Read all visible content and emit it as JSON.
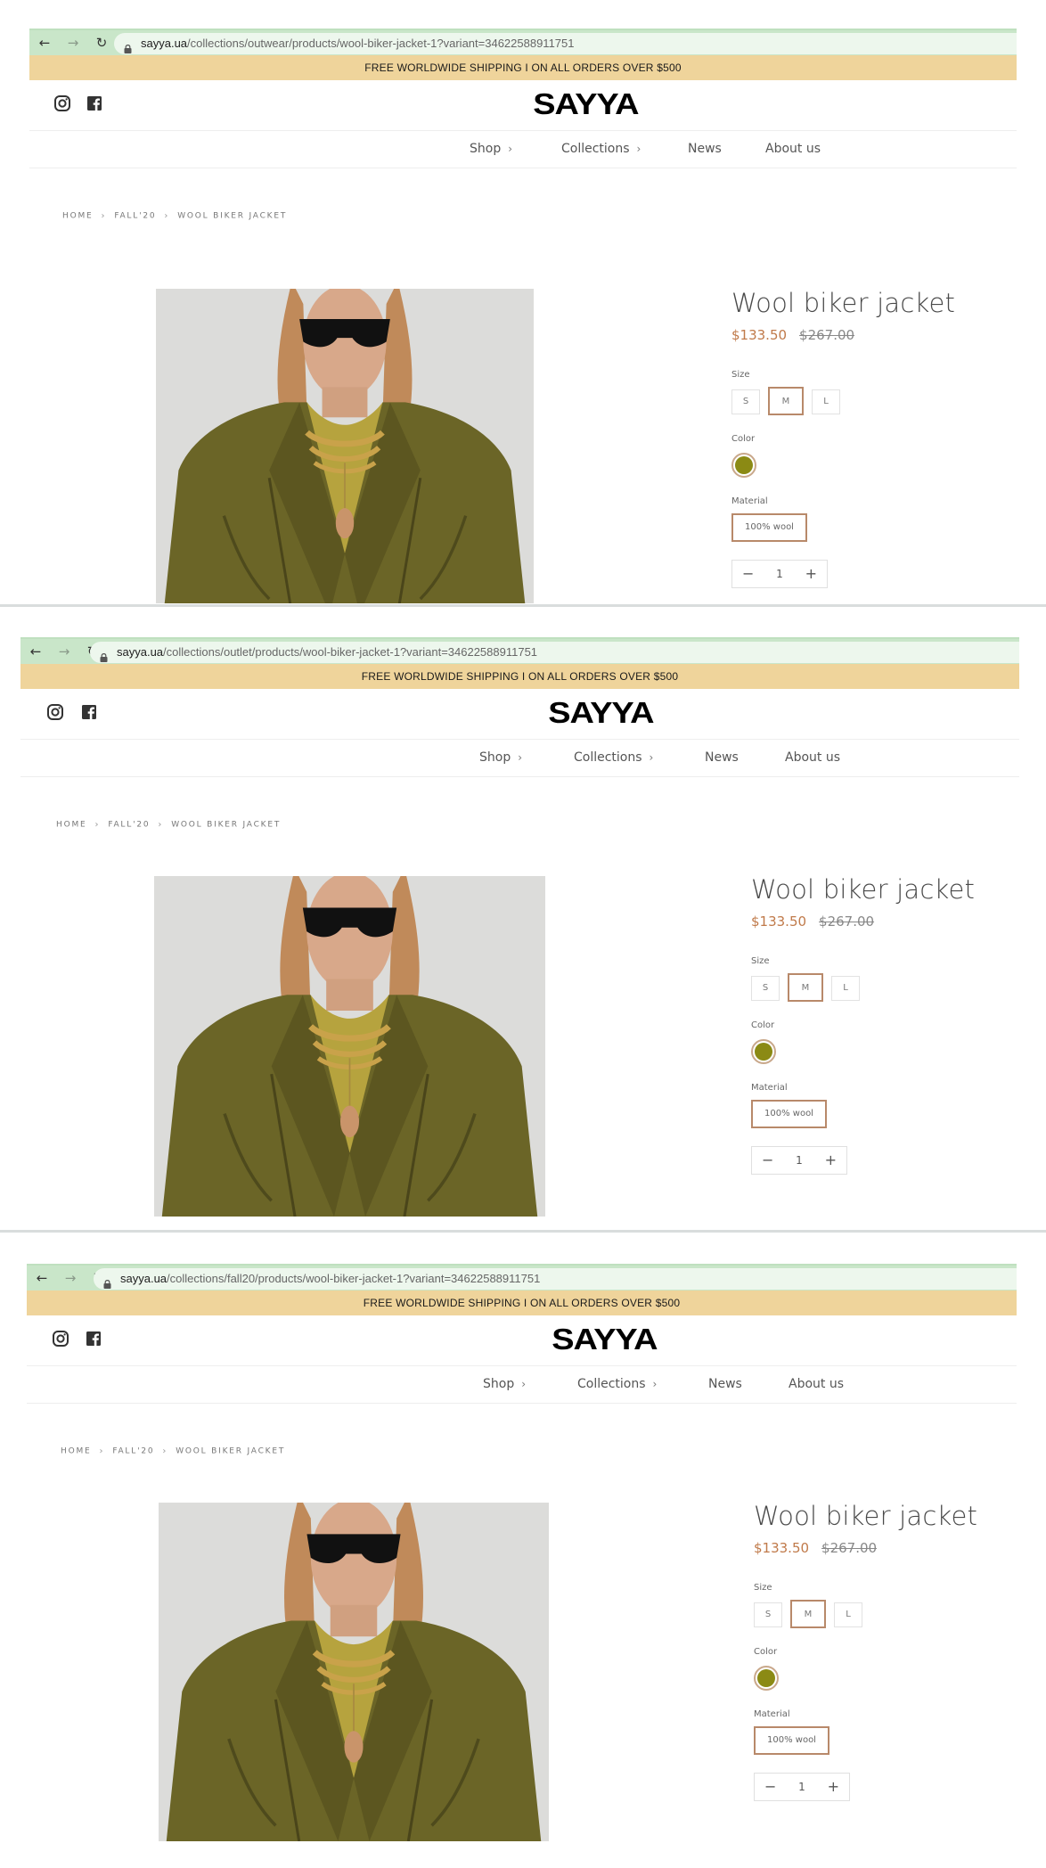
{
  "screens": [
    {
      "nav": {
        "back": "←",
        "forward": "→",
        "reload": "↻"
      },
      "url": {
        "domain": "sayya.ua",
        "path": "/collections/outwear/products/wool-biker-jacket-1?variant=34622588911751"
      },
      "promo": "FREE WORLDWIDE SHIPPING I ON ALL ORDERS OVER $500",
      "logo": "SAYYA",
      "menu": [
        "Shop",
        "Collections",
        "News",
        "About us"
      ],
      "breadcrumb": [
        "HOME",
        "FALL'20",
        "WOOL BIKER JACKET"
      ],
      "product": {
        "title": "Wool biker jacket",
        "price_sale": "$133.50",
        "price_compare": "$267.00",
        "size_label": "Size",
        "sizes": [
          "S",
          "M",
          "L"
        ],
        "selected_size": "M",
        "color_label": "Color",
        "color_hex": "#8b8a14",
        "material_label": "Material",
        "material": "100% wool",
        "qty_minus": "−",
        "qty_value": "1",
        "qty_plus": "+"
      }
    },
    {
      "nav": {
        "back": "←",
        "forward": "→",
        "reload": "↻"
      },
      "url": {
        "domain": "sayya.ua",
        "path": "/collections/outlet/products/wool-biker-jacket-1?variant=34622588911751"
      },
      "promo": "FREE WORLDWIDE SHIPPING I ON ALL ORDERS OVER $500",
      "logo": "SAYYA",
      "menu": [
        "Shop",
        "Collections",
        "News",
        "About us"
      ],
      "breadcrumb": [
        "HOME",
        "FALL'20",
        "WOOL BIKER JACKET"
      ],
      "product": {
        "title": "Wool biker jacket",
        "price_sale": "$133.50",
        "price_compare": "$267.00",
        "size_label": "Size",
        "sizes": [
          "S",
          "M",
          "L"
        ],
        "selected_size": "M",
        "color_label": "Color",
        "color_hex": "#8b8a14",
        "material_label": "Material",
        "material": "100% wool",
        "qty_minus": "−",
        "qty_value": "1",
        "qty_plus": "+"
      }
    },
    {
      "nav": {
        "back": "←",
        "forward": "→",
        "reload": "↻"
      },
      "url": {
        "domain": "sayya.ua",
        "path": "/collections/fall20/products/wool-biker-jacket-1?variant=34622588911751"
      },
      "promo": "FREE WORLDWIDE SHIPPING I ON ALL ORDERS OVER $500",
      "logo": "SAYYA",
      "menu": [
        "Shop",
        "Collections",
        "News",
        "About us"
      ],
      "breadcrumb": [
        "HOME",
        "FALL'20",
        "WOOL BIKER JACKET"
      ],
      "product": {
        "title": "Wool biker jacket",
        "price_sale": "$133.50",
        "price_compare": "$267.00",
        "size_label": "Size",
        "sizes": [
          "S",
          "M",
          "L"
        ],
        "selected_size": "M",
        "color_label": "Color",
        "color_hex": "#8b8a14",
        "material_label": "Material",
        "material": "100% wool",
        "qty_minus": "−",
        "qty_value": "1",
        "qty_plus": "+"
      }
    }
  ],
  "colors": {
    "browser_bar": "#c9e6c9",
    "url_pill": "#edf7ed",
    "promo_bar": "#efd49b",
    "price_sale": "#c07a4a",
    "selected_border": "#b8896a"
  },
  "icons": {
    "instagram": "instagram-icon",
    "facebook": "facebook-icon",
    "lock": "lock-icon",
    "chevron": "chevron-right-icon"
  }
}
